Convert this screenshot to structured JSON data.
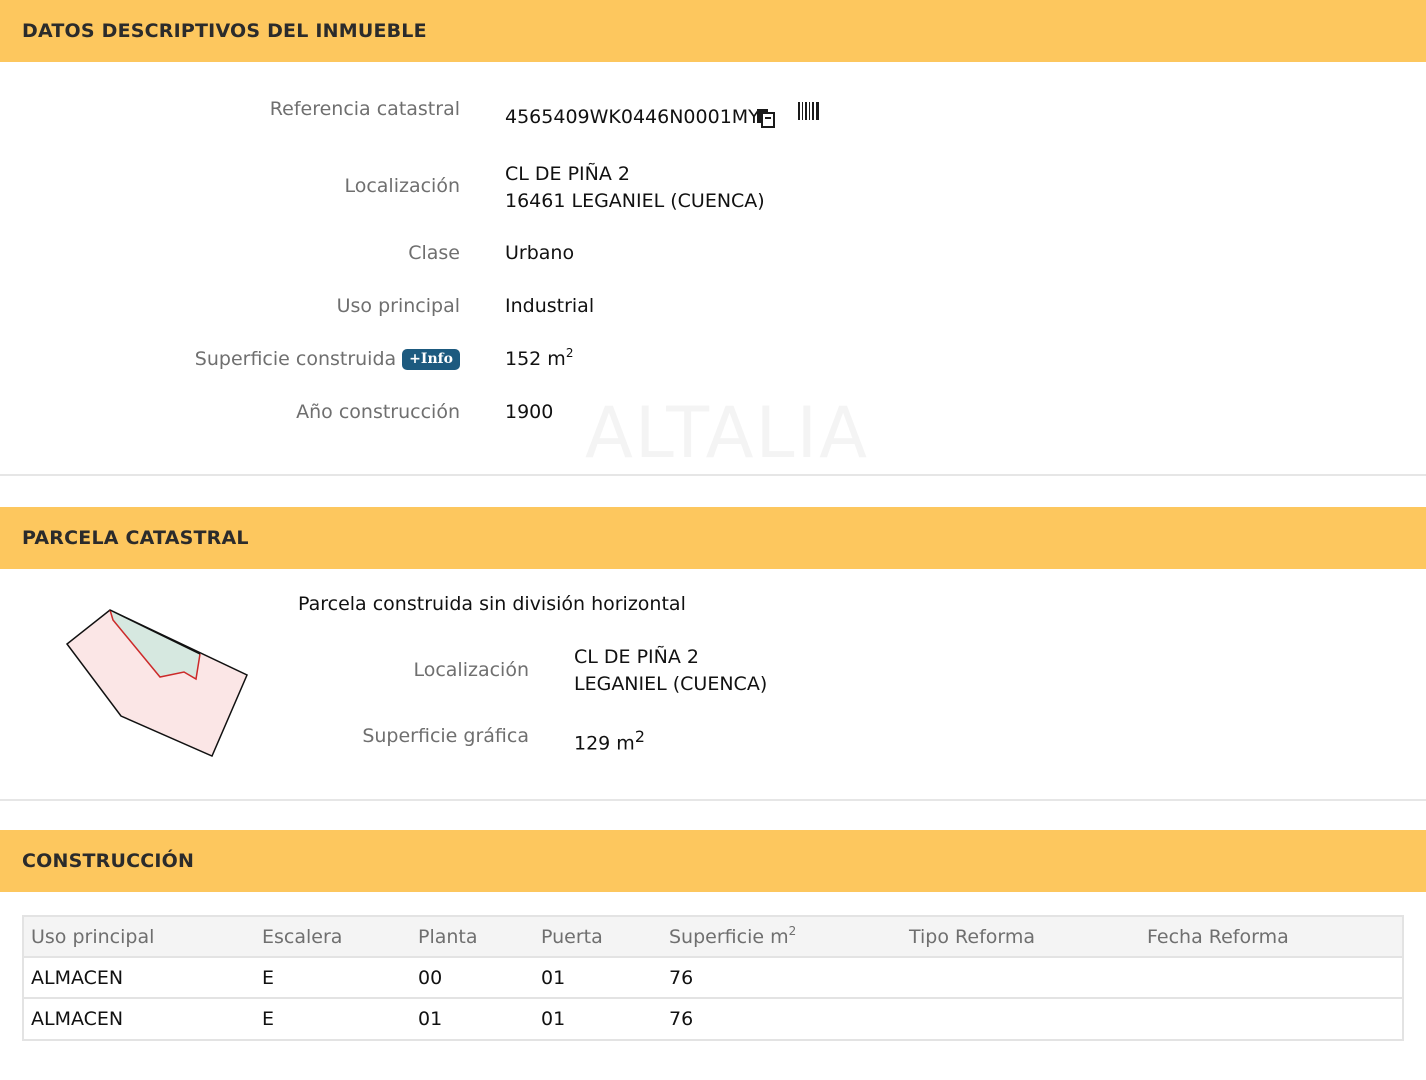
{
  "datos": {
    "header": "DATOS DESCRIPTIVOS DEL INMUEBLE",
    "referencia_label": "Referencia catastral",
    "referencia_value": "4565409WK0446N0001MY",
    "localizacion_label": "Localización",
    "localizacion_line1": "CL DE PIÑA 2",
    "localizacion_line2": "16461 LEGANIEL (CUENCA)",
    "clase_label": "Clase",
    "clase_value": "Urbano",
    "uso_label": "Uso principal",
    "uso_value": "Industrial",
    "superficie_label": "Superficie construida",
    "info_badge": "+Info",
    "superficie_value": "152 m",
    "superficie_unit_exp": "2",
    "anio_label": "Año construcción",
    "anio_value": "1900",
    "watermark": "ALTALIA"
  },
  "parcela": {
    "header": "PARCELA CATASTRAL",
    "subtitle": "Parcela construida sin división horizontal",
    "localizacion_label": "Localización",
    "localizacion_line1": "CL DE PIÑA 2",
    "localizacion_line2": "LEGANIEL (CUENCA)",
    "superficie_label": "Superficie gráfica",
    "superficie_value": "129 m",
    "superficie_unit_exp": "2",
    "map_colors": {
      "parcel_fill": "#fbe6e6",
      "building_fill": "#d6e8e0",
      "outline": "#111111",
      "building_edge": "#cc2a2a"
    }
  },
  "construccion": {
    "header": "CONSTRUCCIÓN",
    "columns": [
      "Uso principal",
      "Escalera",
      "Planta",
      "Puerta",
      "Superficie m",
      "Tipo Reforma",
      "Fecha Reforma"
    ],
    "superficie_exp": "2",
    "rows": [
      [
        "ALMACEN",
        "E",
        "00",
        "01",
        "76",
        "",
        ""
      ],
      [
        "ALMACEN",
        "E",
        "01",
        "01",
        "76",
        "",
        ""
      ]
    ]
  },
  "colors": {
    "header_bg": "#fdc75e",
    "label_text": "#6f6f6f",
    "badge_bg": "#1d5a7f"
  },
  "icons": {
    "copy": "copy-icon",
    "barcode": "barcode-icon"
  }
}
